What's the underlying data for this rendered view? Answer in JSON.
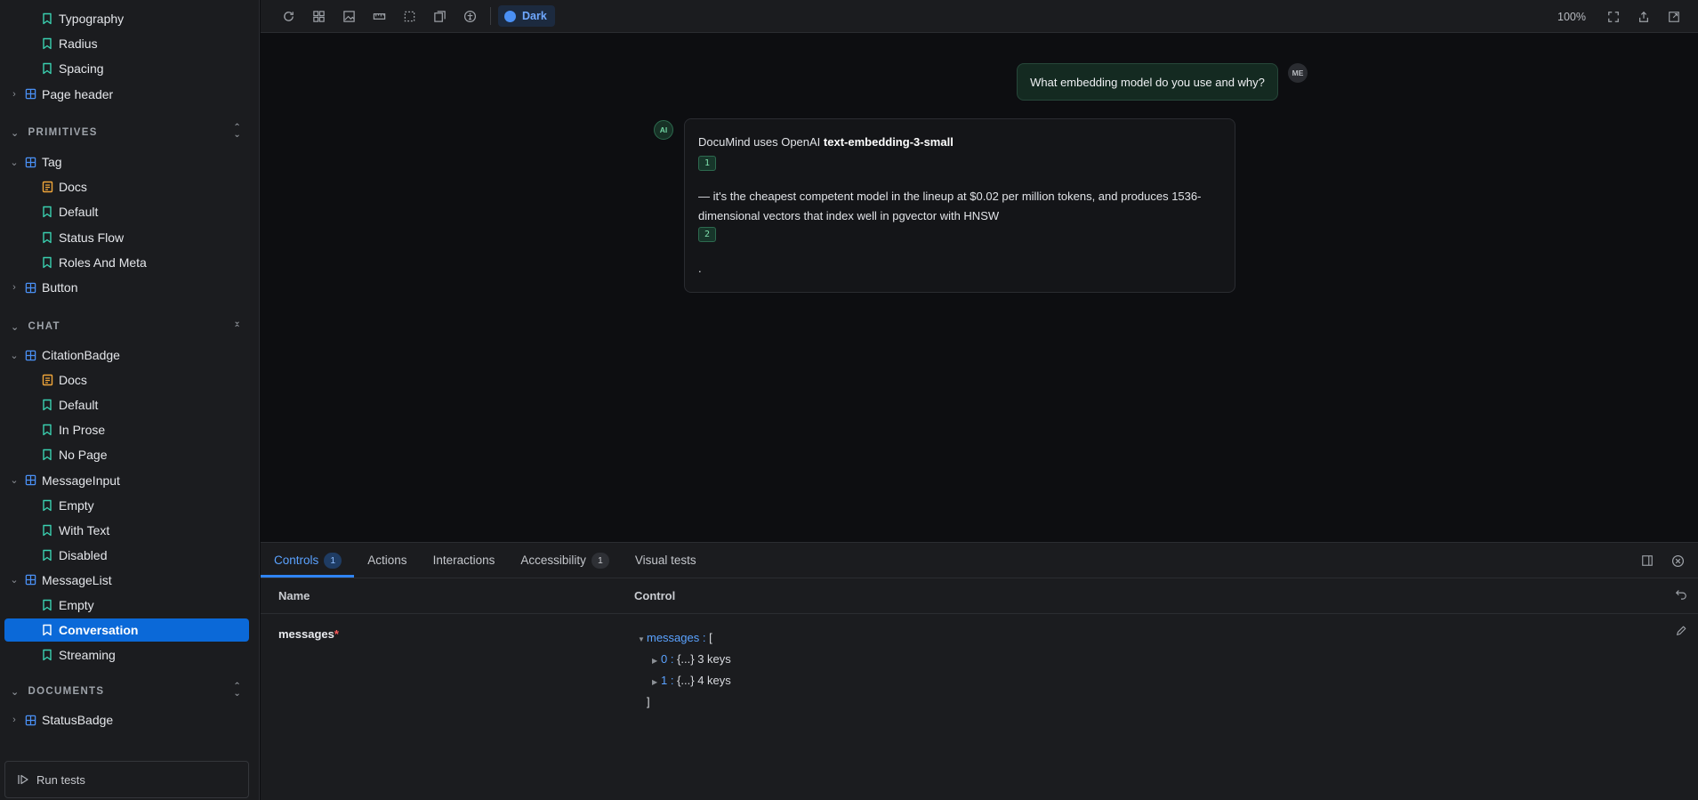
{
  "sidebar": {
    "rows": [
      {
        "label": "Typography",
        "kind": "story",
        "level": 1
      },
      {
        "label": "Radius",
        "kind": "story",
        "level": 1
      },
      {
        "label": "Spacing",
        "kind": "story",
        "level": 1
      },
      {
        "label": "Page header",
        "kind": "component",
        "level": 0,
        "expanded": false
      }
    ],
    "sections": {
      "primitives": {
        "label": "PRIMITIVES"
      },
      "chat": {
        "label": "CHAT"
      },
      "documents": {
        "label": "DOCUMENTS"
      }
    },
    "primitives_rows": [
      {
        "label": "Tag",
        "kind": "component",
        "level": 0,
        "expanded": true
      },
      {
        "label": "Docs",
        "kind": "docs",
        "level": 1
      },
      {
        "label": "Default",
        "kind": "story",
        "level": 1
      },
      {
        "label": "Status Flow",
        "kind": "story",
        "level": 1
      },
      {
        "label": "Roles And Meta",
        "kind": "story",
        "level": 1
      },
      {
        "label": "Button",
        "kind": "component",
        "level": 0,
        "expanded": false
      }
    ],
    "chat_rows": [
      {
        "label": "CitationBadge",
        "kind": "component",
        "level": 0,
        "expanded": true
      },
      {
        "label": "Docs",
        "kind": "docs",
        "level": 1
      },
      {
        "label": "Default",
        "kind": "story",
        "level": 1
      },
      {
        "label": "In Prose",
        "kind": "story",
        "level": 1
      },
      {
        "label": "No Page",
        "kind": "story",
        "level": 1
      },
      {
        "label": "MessageInput",
        "kind": "component",
        "level": 0,
        "expanded": true
      },
      {
        "label": "Empty",
        "kind": "story",
        "level": 1
      },
      {
        "label": "With Text",
        "kind": "story",
        "level": 1
      },
      {
        "label": "Disabled",
        "kind": "story",
        "level": 1
      },
      {
        "label": "MessageList",
        "kind": "component",
        "level": 0,
        "expanded": true
      },
      {
        "label": "Empty",
        "kind": "story",
        "level": 1
      },
      {
        "label": "Conversation",
        "kind": "story",
        "level": 1,
        "selected": true
      },
      {
        "label": "Streaming",
        "kind": "story",
        "level": 1
      }
    ],
    "documents_rows": [
      {
        "label": "StatusBadge",
        "kind": "component",
        "level": 0,
        "expanded": false
      }
    ],
    "run_tests_label": "Run tests"
  },
  "toolbar": {
    "icons": [
      "reload-icon",
      "grid-icon",
      "image-icon",
      "ruler-icon",
      "outline-icon",
      "viewport-icon",
      "accessibility-icon"
    ],
    "theme_label": "Dark",
    "zoom": "100%"
  },
  "canvas": {
    "user_message": "What embedding model do you use and why?",
    "user_avatar": "ME",
    "ai_avatar": "AI",
    "ai_intro": "DocuMind uses OpenAI ",
    "ai_model": "text-embedding-3-small",
    "citation_1": "1",
    "ai_body": "— it's the cheapest competent model in the lineup at $0.02 per million tokens, and produces 1536-dimensional vectors that index well in pgvector with HNSW",
    "citation_2": "2",
    "ai_end": "."
  },
  "panel": {
    "tabs": [
      {
        "label": "Controls",
        "count": "1",
        "active": true
      },
      {
        "label": "Actions"
      },
      {
        "label": "Interactions"
      },
      {
        "label": "Accessibility",
        "count": "1"
      },
      {
        "label": "Visual tests"
      }
    ],
    "columns": {
      "name": "Name",
      "control": "Control"
    },
    "prop": {
      "name": "messages",
      "required_mark": "*"
    },
    "json": {
      "root_key": "messages",
      "root_sep": " : ",
      "open": "[",
      "items": [
        {
          "index": "0",
          "sep": " : ",
          "summary": "{...} 3 keys"
        },
        {
          "index": "1",
          "sep": " : ",
          "summary": "{...} 4 keys"
        }
      ],
      "close": "]"
    }
  },
  "colors": {
    "accent": "#0b69d8",
    "story_icon": "#3ad0b0",
    "component_icon": "#4a90f5",
    "docs_icon": "#f0a63a",
    "citation": "#7fe0ad"
  }
}
